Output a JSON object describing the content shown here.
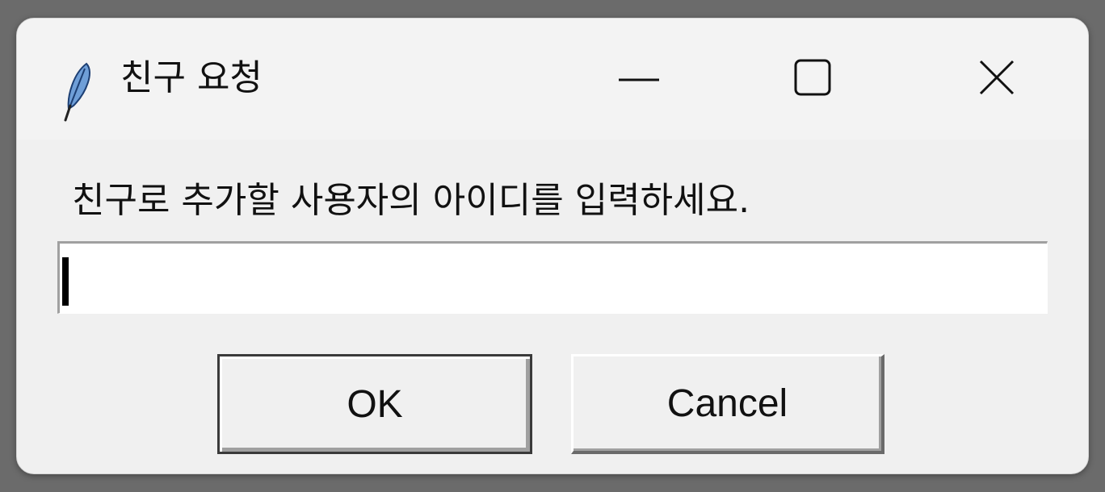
{
  "window": {
    "title": "친구 요청",
    "icon": "feather-icon",
    "controls": [
      "minimize-icon",
      "maximize-icon",
      "close-icon"
    ]
  },
  "dialog": {
    "prompt": "친구로 추가할 사용자의 아이디를 입력하세요.",
    "input_value": "",
    "ok_label": "OK",
    "cancel_label": "Cancel"
  },
  "colors": {
    "dialog_background": "#f0f0f0",
    "input_background": "#ffffff",
    "backdrop": "#6b6b6b"
  }
}
